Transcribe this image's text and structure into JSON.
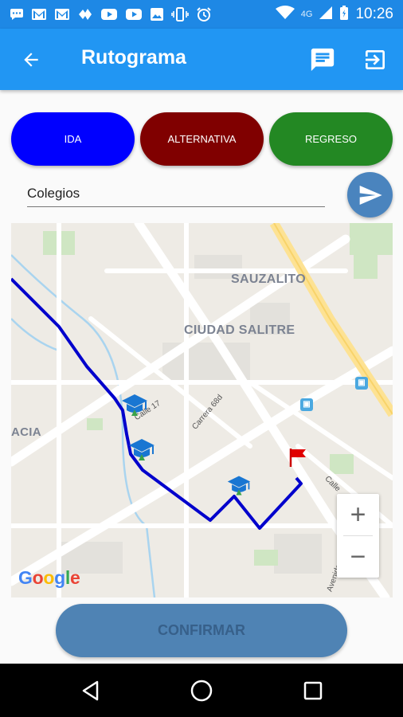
{
  "status_bar": {
    "icons": [
      "message-icon",
      "gmail-icon",
      "gmail-icon",
      "app-icon",
      "youtube-icon",
      "youtube-icon",
      "image-icon",
      "vibrate-icon",
      "alarm-icon",
      "wifi-icon",
      "signal-icon",
      "battery-icon"
    ],
    "network": "4G",
    "time": "10:26"
  },
  "app_bar": {
    "title": "Rutograma",
    "background": "#2196F3"
  },
  "route_buttons": {
    "ida": "IDA",
    "alternativa": "ALTERNATIVA",
    "regreso": "REGRESO",
    "colors": {
      "ida": "#0000FF",
      "alternativa": "#800000",
      "regreso": "#238823"
    }
  },
  "destination": {
    "value": "Colegios"
  },
  "map": {
    "labels": {
      "sauzalito": "SAUZALITO",
      "ciudad_salitre": "CIUDAD SALITRE",
      "partial_left": "ACIA"
    },
    "streets": {
      "calle_17": "Calle 17",
      "carrera_68d": "Carrera 68d",
      "calle_right": "Calle",
      "avenida": "Avenida"
    },
    "markers": [
      "school-icon",
      "school-icon",
      "school-icon"
    ],
    "destination_marker": "flag-icon",
    "route_color": "#0000CC",
    "zoom_in": "+",
    "zoom_out": "−",
    "logo": "Google"
  },
  "confirm_button": {
    "label": "CONFIRMAR"
  }
}
